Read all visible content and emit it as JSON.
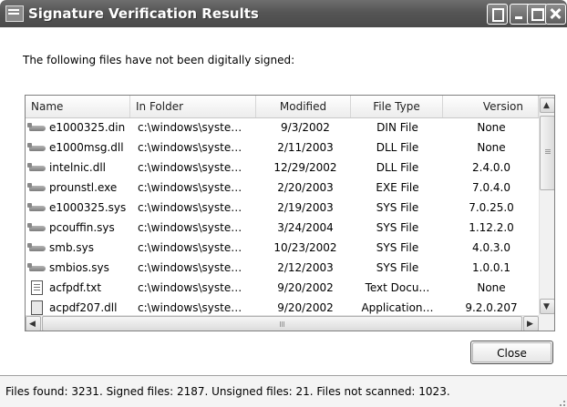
{
  "window": {
    "title": "Signature Verification Results"
  },
  "intro_text": "The following files have not been digitally signed:",
  "columns": [
    "Name",
    "In Folder",
    "Modified",
    "File Type",
    "Version"
  ],
  "rows": [
    {
      "name": "e1000325.din",
      "folder": "c:\\windows\\syste…",
      "modified": "9/3/2002",
      "type": "DIN File",
      "version": "None",
      "icon": "driver-icon"
    },
    {
      "name": "e1000msg.dll",
      "folder": "c:\\windows\\syste…",
      "modified": "2/11/2003",
      "type": "DLL File",
      "version": "None",
      "icon": "driver-icon"
    },
    {
      "name": "intelnic.dll",
      "folder": "c:\\windows\\syste…",
      "modified": "12/29/2002",
      "type": "DLL File",
      "version": "2.4.0.0",
      "icon": "driver-icon"
    },
    {
      "name": "prounstl.exe",
      "folder": "c:\\windows\\syste…",
      "modified": "2/20/2003",
      "type": "EXE File",
      "version": "7.0.4.0",
      "icon": "driver-icon"
    },
    {
      "name": "e1000325.sys",
      "folder": "c:\\windows\\syste…",
      "modified": "2/19/2003",
      "type": "SYS File",
      "version": "7.0.25.0",
      "icon": "driver-icon"
    },
    {
      "name": "pcouffin.sys",
      "folder": "c:\\windows\\syste…",
      "modified": "3/24/2004",
      "type": "SYS File",
      "version": "1.12.2.0",
      "icon": "driver-icon"
    },
    {
      "name": "smb.sys",
      "folder": "c:\\windows\\syste…",
      "modified": "10/23/2002",
      "type": "SYS File",
      "version": "4.0.3.0",
      "icon": "driver-icon"
    },
    {
      "name": "smbios.sys",
      "folder": "c:\\windows\\syste…",
      "modified": "2/12/2003",
      "type": "SYS File",
      "version": "1.0.0.1",
      "icon": "driver-icon"
    },
    {
      "name": "acfpdf.txt",
      "folder": "c:\\windows\\syste…",
      "modified": "9/20/2002",
      "type": "Text Docu…",
      "version": "None",
      "icon": "text-document-icon"
    },
    {
      "name": "acpdf207.dll",
      "folder": "c:\\windows\\syste…",
      "modified": "9/20/2002",
      "type": "Application…",
      "version": "9.2.0.207",
      "icon": "application-icon"
    }
  ],
  "buttons": {
    "close": "Close"
  },
  "status": "Files found: 3231.  Signed files: 2187.  Unsigned files: 21.  Files not scanned: 1023."
}
